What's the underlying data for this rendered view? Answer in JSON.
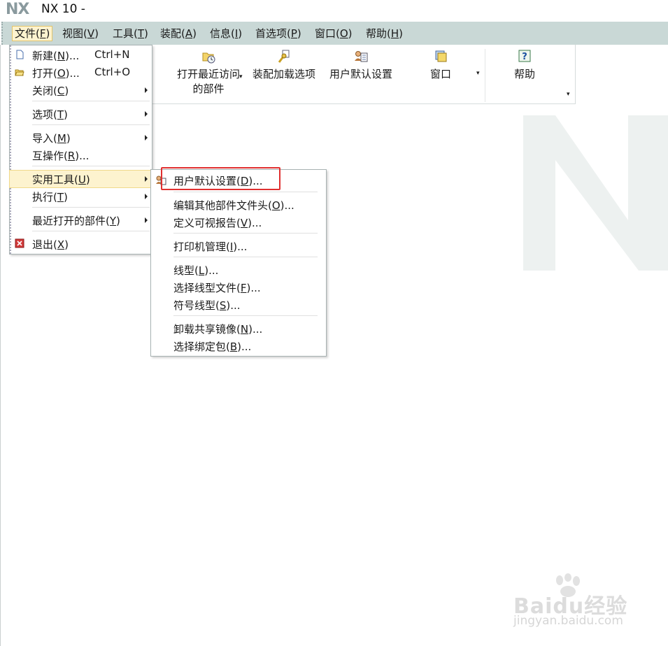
{
  "window": {
    "logo": "NX",
    "title": "NX 10 -"
  },
  "menubar": {
    "items": [
      {
        "label": "文件(",
        "mnemonic": "F",
        "suffix": ")"
      },
      {
        "label": "视图(",
        "mnemonic": "V",
        "suffix": ")"
      },
      {
        "label": "工具(",
        "mnemonic": "T",
        "suffix": ")"
      },
      {
        "label": "装配(",
        "mnemonic": "A",
        "suffix": ")"
      },
      {
        "label": "信息(",
        "mnemonic": "I",
        "suffix": ")"
      },
      {
        "label": "首选项(",
        "mnemonic": "P",
        "suffix": ")"
      },
      {
        "label": "窗口(",
        "mnemonic": "O",
        "suffix": ")"
      },
      {
        "label": "帮助(",
        "mnemonic": "H",
        "suffix": ")"
      }
    ]
  },
  "ribbon": {
    "recent_parts_line1": "打开最近访问",
    "recent_parts_line2": "的部件",
    "assembly_load_options": "装配加载选项",
    "user_defaults": "用户默认设置",
    "window": "窗口",
    "help": "帮助"
  },
  "file_menu": {
    "new": {
      "pre": "新建(",
      "mn": "N",
      "post": ")...",
      "shortcut": "Ctrl+N"
    },
    "open": {
      "pre": "打开(",
      "mn": "O",
      "post": ")...",
      "shortcut": "Ctrl+O"
    },
    "close": {
      "pre": "关闭(",
      "mn": "C",
      "post": ")"
    },
    "options": {
      "pre": "选项(",
      "mn": "T",
      "post": ")"
    },
    "import": {
      "pre": "导入(",
      "mn": "M",
      "post": ")"
    },
    "interop": {
      "pre": "互操作(",
      "mn": "R",
      "post": ")..."
    },
    "utilities": {
      "pre": "实用工具(",
      "mn": "U",
      "post": ")"
    },
    "execute": {
      "pre": "执行(",
      "mn": "T",
      "post": ")"
    },
    "recent": {
      "pre": "最近打开的部件(",
      "mn": "Y",
      "post": ")"
    },
    "exit": {
      "pre": "退出(",
      "mn": "X",
      "post": ")"
    }
  },
  "utilities_submenu": {
    "user_defaults": {
      "pre": "用户默认设置(",
      "mn": "D",
      "post": ")..."
    },
    "edit_part_header": {
      "pre": "编辑其他部件文件头(",
      "mn": "O",
      "post": ")..."
    },
    "visual_report": {
      "pre": "定义可视报告(",
      "mn": "V",
      "post": ")..."
    },
    "printer_admin": {
      "pre": "打印机管理(",
      "mn": "I",
      "post": ")..."
    },
    "line_font": {
      "pre": "线型(",
      "mn": "L",
      "post": ")..."
    },
    "select_line_font_file": {
      "pre": "选择线型文件(",
      "mn": "F",
      "post": ")..."
    },
    "symbol_font": {
      "pre": "符号线型(",
      "mn": "S",
      "post": ")..."
    },
    "unload_shared_image": {
      "pre": "卸载共享镜像(",
      "mn": "N",
      "post": ")..."
    },
    "select_bundle": {
      "pre": "选择绑定包(",
      "mn": "B",
      "post": ")..."
    }
  },
  "watermark": {
    "brand": "Baidu经验",
    "url": "jingyan.baidu.com"
  },
  "colors": {
    "menubar_bg": "#c9d8d6",
    "highlight_bg": "#fdf3cf",
    "callout_red": "#e03030"
  }
}
